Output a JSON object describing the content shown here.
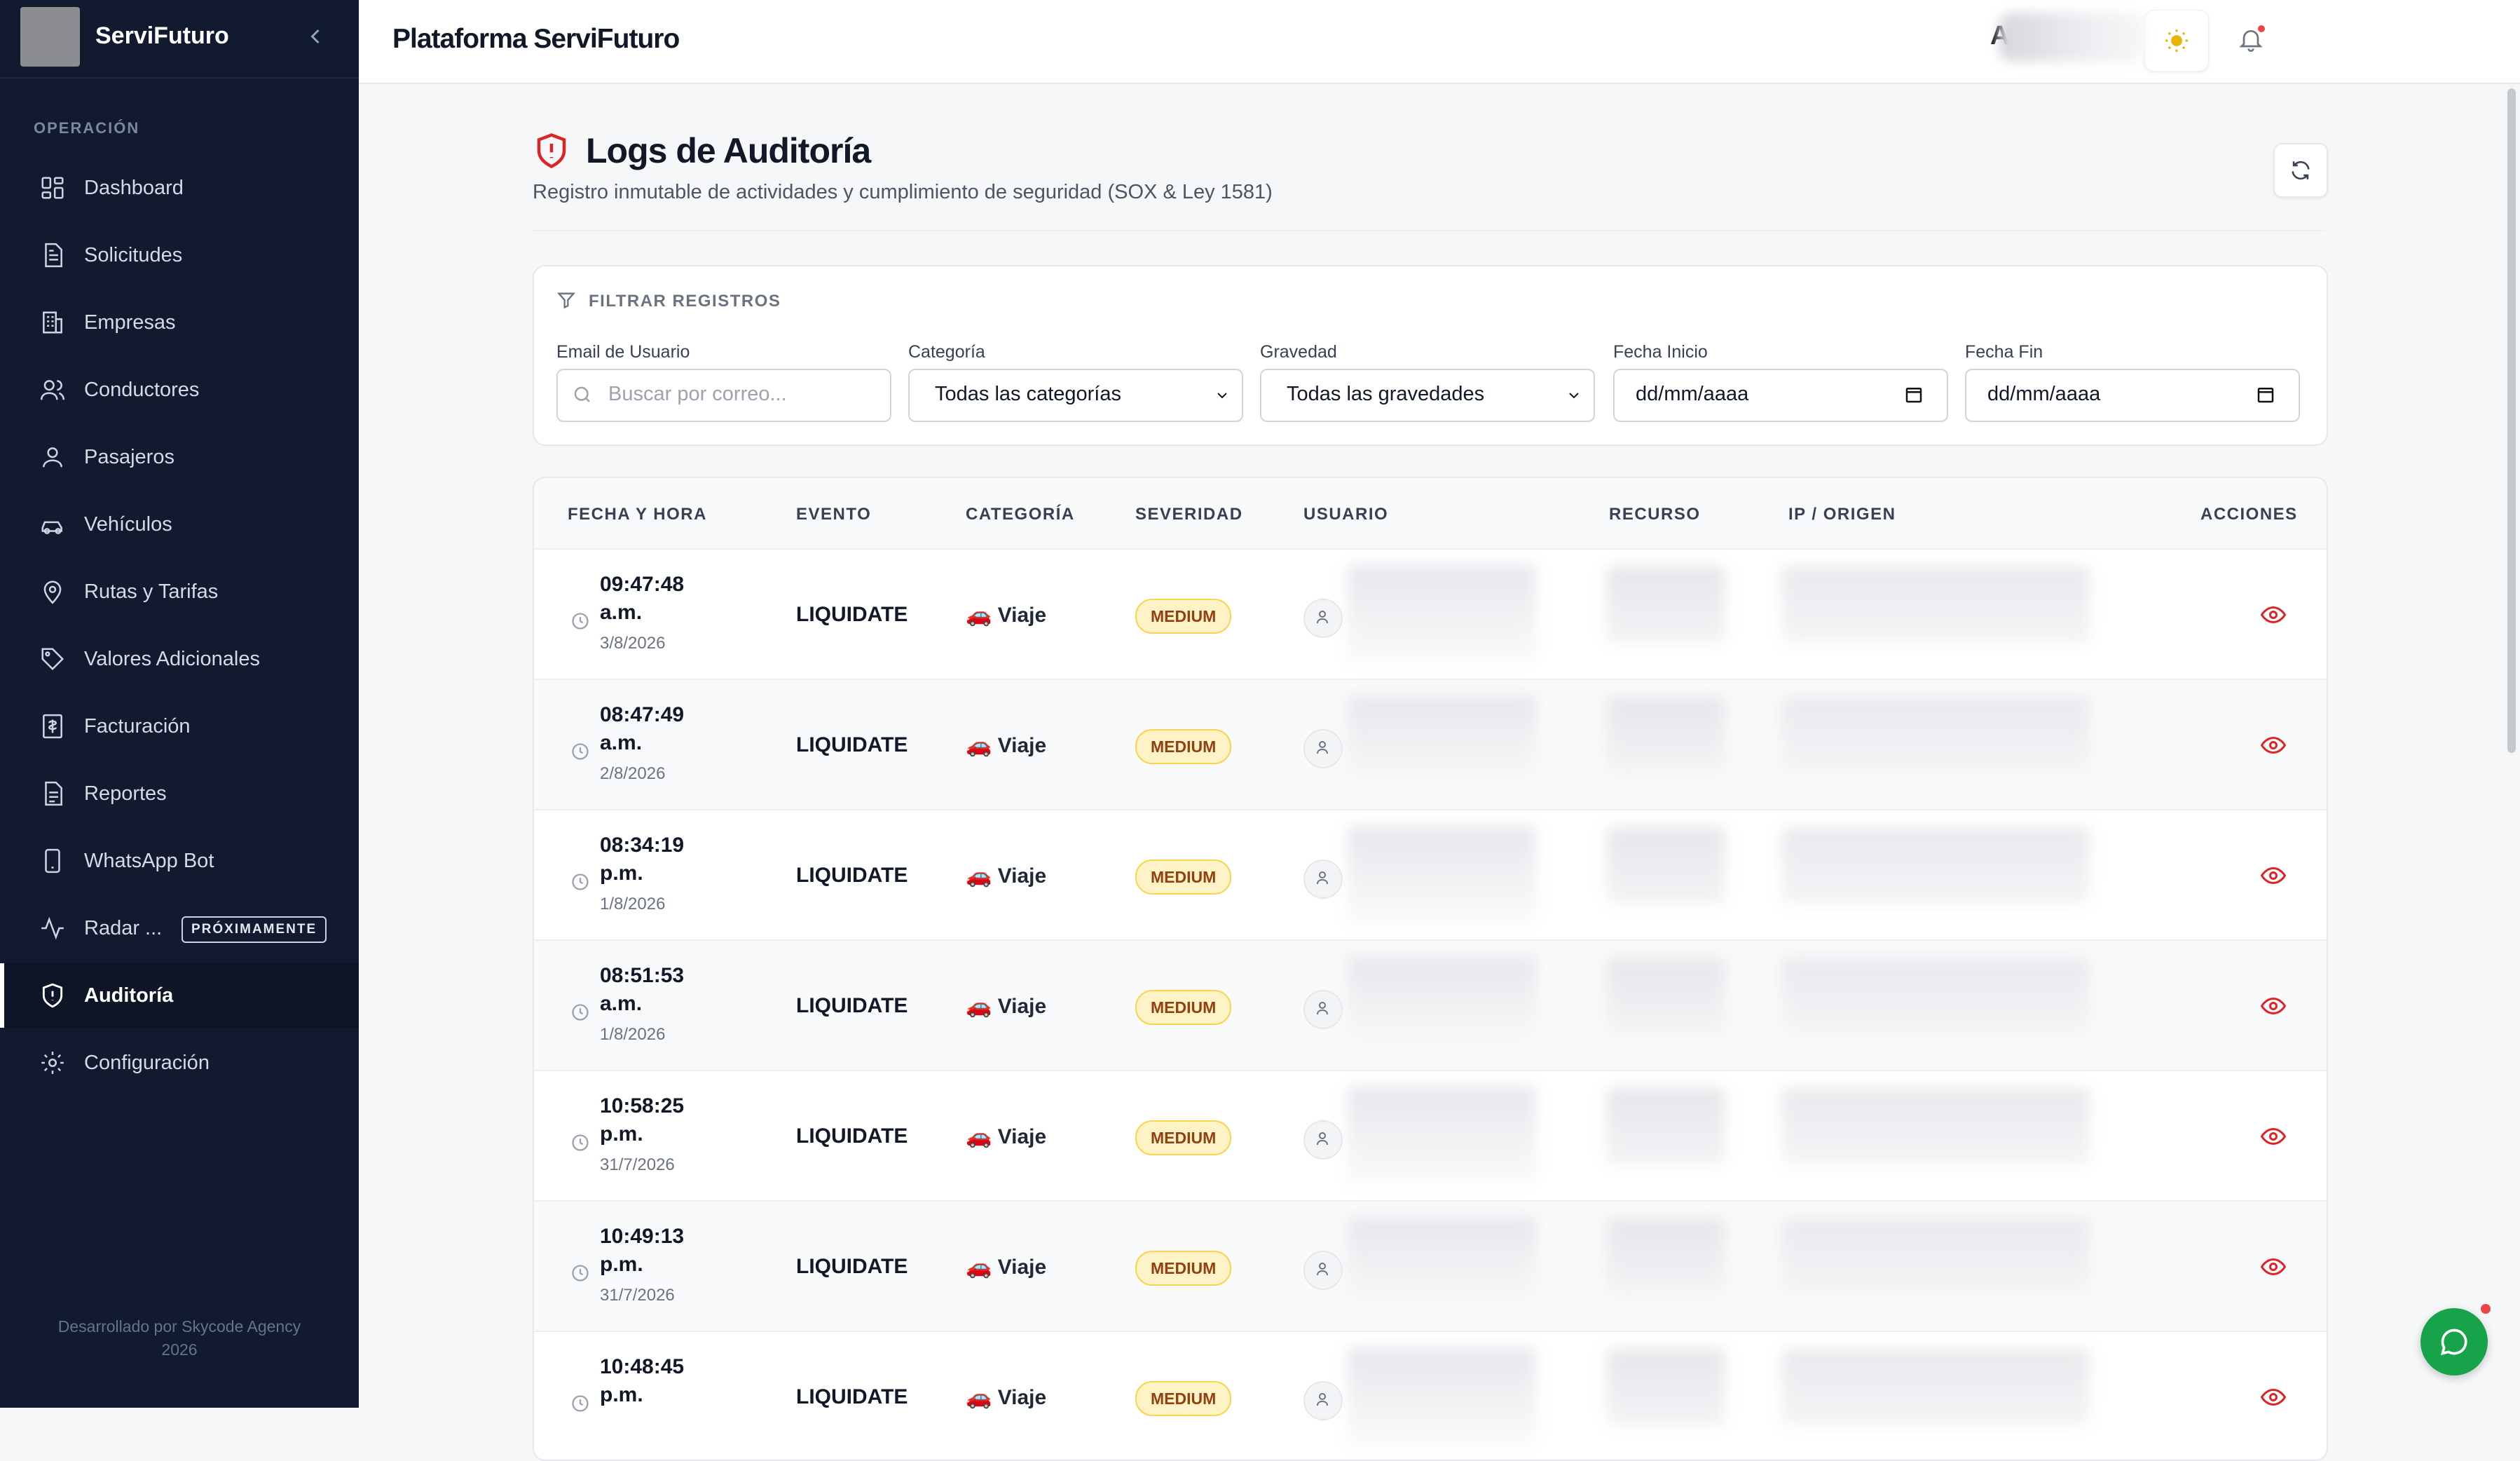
{
  "sidebar": {
    "app_name": "ServiFuturo",
    "section_label": "OPERACIÓN",
    "items": [
      {
        "label": "Dashboard",
        "icon": "dashboard-icon"
      },
      {
        "label": "Solicitudes",
        "icon": "document-icon"
      },
      {
        "label": "Empresas",
        "icon": "building-icon"
      },
      {
        "label": "Conductores",
        "icon": "users-icon"
      },
      {
        "label": "Pasajeros",
        "icon": "user-icon"
      },
      {
        "label": "Vehículos",
        "icon": "car-icon"
      },
      {
        "label": "Rutas y Tarifas",
        "icon": "map-pin-icon"
      },
      {
        "label": "Valores Adicionales",
        "icon": "tag-icon"
      },
      {
        "label": "Facturación",
        "icon": "invoice-icon"
      },
      {
        "label": "Reportes",
        "icon": "report-icon"
      },
      {
        "label": "WhatsApp Bot",
        "icon": "phone-icon"
      },
      {
        "label": "Radar ...",
        "icon": "activity-icon",
        "badge": "PRÓXIMAMENTE"
      },
      {
        "label": "Auditoría",
        "icon": "shield-icon",
        "active": true
      },
      {
        "label": "Configuración",
        "icon": "gear-icon"
      }
    ],
    "footer_line1": "Desarrollado por Skycode Agency",
    "footer_line2": "2026"
  },
  "topbar": {
    "title": "Plataforma ServiFuturo",
    "avatar_letter": "A"
  },
  "page": {
    "title": "Logs de Auditoría",
    "subtitle": "Registro inmutable de actividades y cumplimiento de seguridad (SOX & Ley 1581)"
  },
  "filters": {
    "heading": "FILTRAR REGISTROS",
    "email": {
      "label": "Email de Usuario",
      "placeholder": "Buscar por correo..."
    },
    "category": {
      "label": "Categoría",
      "value": "Todas las categorías"
    },
    "severity": {
      "label": "Gravedad",
      "value": "Todas las gravedades"
    },
    "start_date": {
      "label": "Fecha Inicio",
      "value": "dd/mm/aaaa"
    },
    "end_date": {
      "label": "Fecha Fin",
      "value": "dd/mm/aaaa"
    }
  },
  "table": {
    "headers": [
      "FECHA Y HORA",
      "EVENTO",
      "CATEGORÍA",
      "SEVERIDAD",
      "USUARIO",
      "RECURSO",
      "IP / ORIGEN",
      "ACCIONES"
    ],
    "rows": [
      {
        "time_1": "09:47:48",
        "time_2": "a.m.",
        "date": "3/8/2026",
        "event": "LIQUIDATE",
        "category": "🚗 Viaje",
        "severity": "MEDIUM"
      },
      {
        "time_1": "08:47:49",
        "time_2": "a.m.",
        "date": "2/8/2026",
        "event": "LIQUIDATE",
        "category": "🚗 Viaje",
        "severity": "MEDIUM"
      },
      {
        "time_1": "08:34:19",
        "time_2": "p.m.",
        "date": "1/8/2026",
        "event": "LIQUIDATE",
        "category": "🚗 Viaje",
        "severity": "MEDIUM"
      },
      {
        "time_1": "08:51:53",
        "time_2": "a.m.",
        "date": "1/8/2026",
        "event": "LIQUIDATE",
        "category": "🚗 Viaje",
        "severity": "MEDIUM"
      },
      {
        "time_1": "10:58:25",
        "time_2": "p.m.",
        "date": "31/7/2026",
        "event": "LIQUIDATE",
        "category": "🚗 Viaje",
        "severity": "MEDIUM"
      },
      {
        "time_1": "10:49:13",
        "time_2": "p.m.",
        "date": "31/7/2026",
        "event": "LIQUIDATE",
        "category": "🚗 Viaje",
        "severity": "MEDIUM"
      },
      {
        "time_1": "10:48:45",
        "time_2": "p.m.",
        "date": "",
        "event": "LIQUIDATE",
        "category": "🚗 Viaje",
        "severity": "MEDIUM"
      }
    ]
  },
  "colors": {
    "sidebar_bg": "#111a2e",
    "accent_red": "#dc2626",
    "severity_bg": "#fef3c7",
    "chat_green": "#16a34a"
  }
}
